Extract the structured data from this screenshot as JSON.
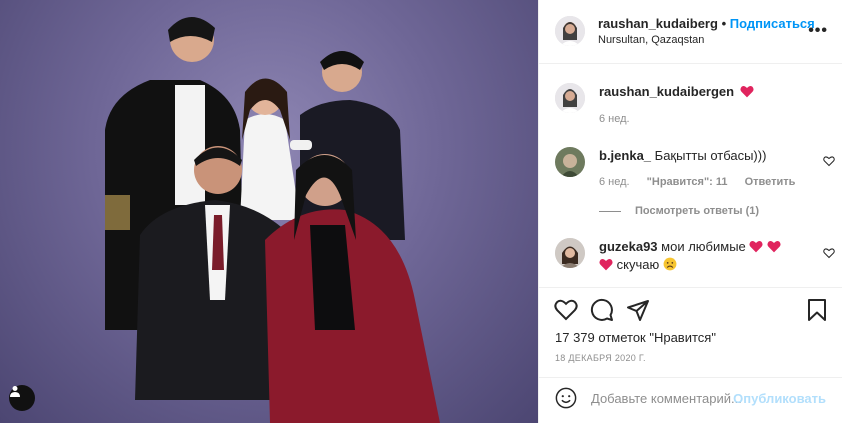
{
  "post": {
    "username": "raushan_kudaiberg",
    "separator": "•",
    "follow_label": "Подписаться",
    "location": "Nursultan, Qazaqstan",
    "more": "•••"
  },
  "caption": {
    "username": "raushan_kudaibergen",
    "emoji": "heart",
    "time": "6 нед."
  },
  "comments": [
    {
      "username": "b.jenka_",
      "text": "Бақытты отбасы)))",
      "time": "6 нед.",
      "likes": "\"Нравится\": 11",
      "reply": "Ответить",
      "view_replies": "Посмотреть ответы (1)"
    },
    {
      "username": "guzeka93",
      "text": "мои любимые",
      "text2": "скучаю"
    }
  ],
  "stats": {
    "likes": "17 379 отметок \"Нравится\"",
    "date": "18 ДЕКАБРЯ 2020 Г."
  },
  "composer": {
    "placeholder": "Добавьте комментарий...",
    "post_label": "Опубликовать"
  },
  "colors": {
    "accent": "#0095f6",
    "heart": "#ed4956",
    "disabled_post": "#b2dffc",
    "background": "#6f6797"
  }
}
